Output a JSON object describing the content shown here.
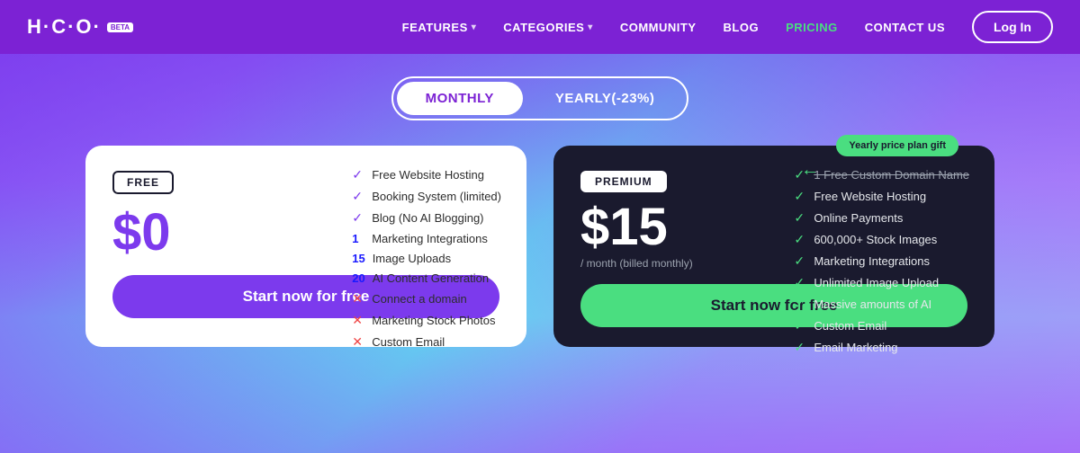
{
  "nav": {
    "logo": "H·C·O·",
    "beta": "BETA",
    "links": [
      {
        "label": "FEATURES",
        "hasDropdown": true,
        "active": false
      },
      {
        "label": "CATEGORIES",
        "hasDropdown": true,
        "active": false
      },
      {
        "label": "COMMUNITY",
        "hasDropdown": false,
        "active": false
      },
      {
        "label": "BLOG",
        "hasDropdown": false,
        "active": false
      },
      {
        "label": "PRICING",
        "hasDropdown": false,
        "active": true
      },
      {
        "label": "CONTACT US",
        "hasDropdown": false,
        "active": false
      }
    ],
    "loginLabel": "Log In"
  },
  "toggle": {
    "monthly": "MONTHLY",
    "yearly": "YEARLY(-23%)"
  },
  "freePlan": {
    "badge": "FREE",
    "price": "$0",
    "features": [
      {
        "type": "check",
        "num": "",
        "text": "Free Website Hosting"
      },
      {
        "type": "check",
        "num": "",
        "text": "Booking System (limited)"
      },
      {
        "type": "check",
        "num": "",
        "text": "Blog (No AI Blogging)"
      },
      {
        "type": "num",
        "num": "1",
        "text": "Marketing Integrations"
      },
      {
        "type": "num",
        "num": "15",
        "text": "Image Uploads"
      },
      {
        "type": "num",
        "num": "20",
        "text": "AI Content Generation"
      },
      {
        "type": "x",
        "num": "",
        "text": "Connect a domain"
      },
      {
        "type": "x",
        "num": "",
        "text": "Marketing Stock Photos"
      },
      {
        "type": "x",
        "num": "",
        "text": "Custom Email"
      }
    ],
    "cta": "Start now for free"
  },
  "premiumPlan": {
    "badge": "PREMIUM",
    "price": "$15",
    "priceSub": "/ month (billed monthly)",
    "yearlyBadge": "Yearly price plan gift",
    "features": [
      {
        "type": "check",
        "text": "1 Free Custom Domain Name",
        "strikethrough": true
      },
      {
        "type": "check",
        "text": "Free Website Hosting",
        "strikethrough": false
      },
      {
        "type": "check",
        "text": "Online Payments",
        "strikethrough": false
      },
      {
        "type": "check",
        "text": "600,000+ Stock Images",
        "strikethrough": false
      },
      {
        "type": "check",
        "text": "Marketing Integrations",
        "strikethrough": false
      },
      {
        "type": "check",
        "text": "Unlimited Image Upload",
        "strikethrough": false
      },
      {
        "type": "check",
        "text": "Massive amounts of AI",
        "strikethrough": false
      },
      {
        "type": "check",
        "text": "Custom Email",
        "strikethrough": false
      },
      {
        "type": "check",
        "text": "Email Marketing",
        "strikethrough": false
      }
    ],
    "cta": "Start now for free"
  }
}
